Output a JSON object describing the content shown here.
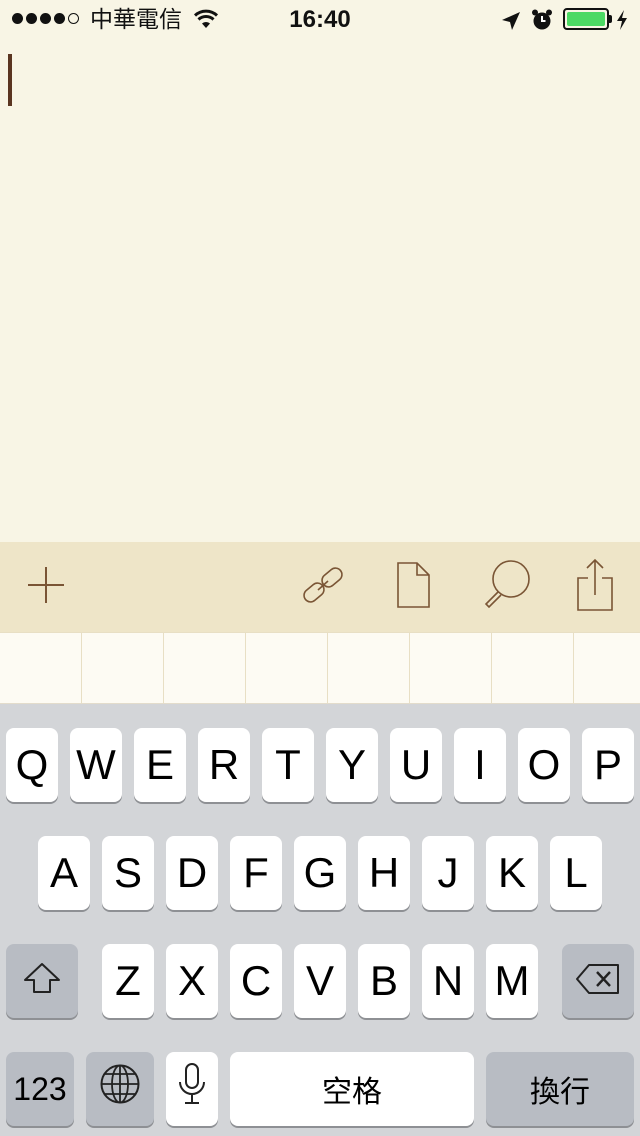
{
  "status_bar": {
    "carrier": "中華電信",
    "time": "16:40",
    "battery_level": 1.0,
    "icons": [
      "signal-dots",
      "wifi-icon",
      "location-icon",
      "alarm-icon",
      "battery-icon",
      "charging-icon"
    ]
  },
  "editor": {
    "text": "",
    "caret_color": "#5a3520",
    "background": "#f8f5e5"
  },
  "toolbar": {
    "background": "#eee5c8",
    "icons": [
      "plus-icon",
      "link-icon",
      "document-icon",
      "search-icon",
      "share-icon"
    ]
  },
  "keyboard": {
    "row1": [
      "Q",
      "W",
      "E",
      "R",
      "T",
      "Y",
      "U",
      "I",
      "O",
      "P"
    ],
    "row2": [
      "A",
      "S",
      "D",
      "F",
      "G",
      "H",
      "J",
      "K",
      "L"
    ],
    "row3": [
      "Z",
      "X",
      "C",
      "V",
      "B",
      "N",
      "M"
    ],
    "numbers_label": "123",
    "space_label": "空格",
    "return_label": "換行"
  }
}
